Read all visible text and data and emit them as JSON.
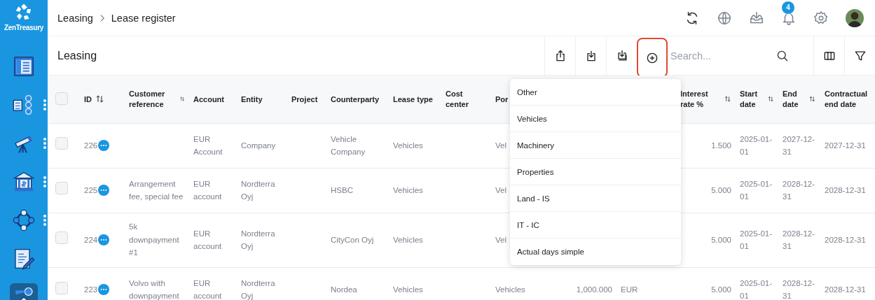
{
  "sidebar": {
    "logo": "ZenTreasury",
    "items": [
      {
        "has_menu": false,
        "selected": false
      },
      {
        "has_menu": true,
        "selected": false
      },
      {
        "has_menu": true,
        "selected": false
      },
      {
        "has_menu": true,
        "selected": false
      },
      {
        "has_menu": true,
        "selected": false
      },
      {
        "has_menu": false,
        "selected": false
      },
      {
        "has_menu": false,
        "selected": true
      }
    ]
  },
  "breadcrumb": [
    "Leasing",
    "Lease register"
  ],
  "notifications": {
    "count": "4"
  },
  "toolbar": {
    "title": "Leasing",
    "buttons": [
      {
        "highlighted": false
      },
      {
        "highlighted": false
      },
      {
        "highlighted": false
      },
      {
        "highlighted": true
      }
    ],
    "search": {
      "placeholder": "Search..."
    }
  },
  "table": {
    "select_all": {
      "checked": false
    },
    "columns": [
      {
        "label": "ID",
        "sortable": true
      },
      {
        "label": "Customer reference",
        "sortable": true
      },
      {
        "label": "Account",
        "sortable": false
      },
      {
        "label": "Entity",
        "sortable": false
      },
      {
        "label": "Project",
        "sortable": false
      },
      {
        "label": "Counterparty",
        "sortable": false
      },
      {
        "label": "Lease type",
        "sortable": false
      },
      {
        "label": "Cost center",
        "sortable": false
      },
      {
        "label": "Por",
        "sortable": false
      },
      {},
      {},
      {
        "label": "Interest rate %",
        "sortable": true
      },
      {
        "label": "Start date",
        "sortable": true
      },
      {
        "label": "End date",
        "sortable": true
      },
      {
        "label": "Contractual end date",
        "sortable": false
      }
    ],
    "rows": [
      {
        "checked": false,
        "cells": [
          "226",
          null,
          "EUR Account",
          "Company",
          null,
          "Vehicle Company",
          "Vehicles",
          null,
          "Vel",
          null,
          null,
          "1.500",
          "2025-01-01",
          "2027-12-31",
          "2027-12-31"
        ]
      },
      {
        "checked": false,
        "cells": [
          "225",
          "Arrangement fee, special fee",
          "EUR account",
          "Nordterra Oyj",
          null,
          "HSBC",
          "Vehicles",
          null,
          "Vel",
          null,
          null,
          "5.000",
          "2025-01-01",
          "2028-12-31",
          "2028-12-31"
        ]
      },
      {
        "checked": false,
        "cells": [
          "224",
          "5k downpayment #1",
          "EUR account",
          "Nordterra Oyj",
          null,
          "CityCon Oyj",
          "Vehicles",
          null,
          "Vel",
          null,
          null,
          "5.000",
          "2025-01-01",
          "2028-12-31",
          "2028-12-31"
        ]
      },
      {
        "checked": false,
        "cells": [
          "223",
          "Volvo with downpayment",
          "EUR account",
          "Nordterra Oyj",
          null,
          "Nordea",
          "Vehicles",
          null,
          "Vehicles",
          "1,000.000",
          "EUR",
          "5.000",
          "2025-01-01",
          "2028-12-31",
          "2028-12-31"
        ]
      }
    ]
  },
  "dropdown": {
    "items": [
      "Other",
      "Vehicles",
      "Machinery",
      "Properties",
      "Land - IS",
      "IT - IC",
      "Actual days simple"
    ]
  }
}
